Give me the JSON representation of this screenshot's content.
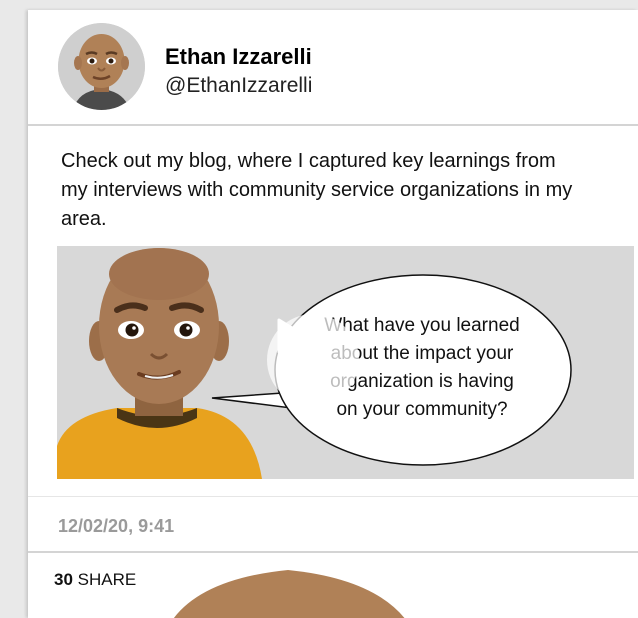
{
  "author": {
    "name": "Ethan Izzarelli",
    "handle": "@EthanIzzarelli",
    "avatar_icon": "memoji-avatar-icon"
  },
  "post": {
    "text": "Check out my blog, where I captured key learnings from my interviews with community service organizations in my area.",
    "video": {
      "speech_bubble_text": "What have you learned about the impact your organization is having on your community?",
      "play_icon": "play-icon"
    },
    "timestamp": "12/02/20,  9:41"
  },
  "stats": {
    "share_count": "30",
    "share_label": "SHARE"
  },
  "colors": {
    "card_background": "#ffffff",
    "page_background": "#e9e9e9",
    "divider": "#d4d4d4",
    "timestamp": "#9a9a9a",
    "video_background": "#d8d8d8",
    "skin": "#a87a55",
    "shirt": "#e8a21e"
  }
}
